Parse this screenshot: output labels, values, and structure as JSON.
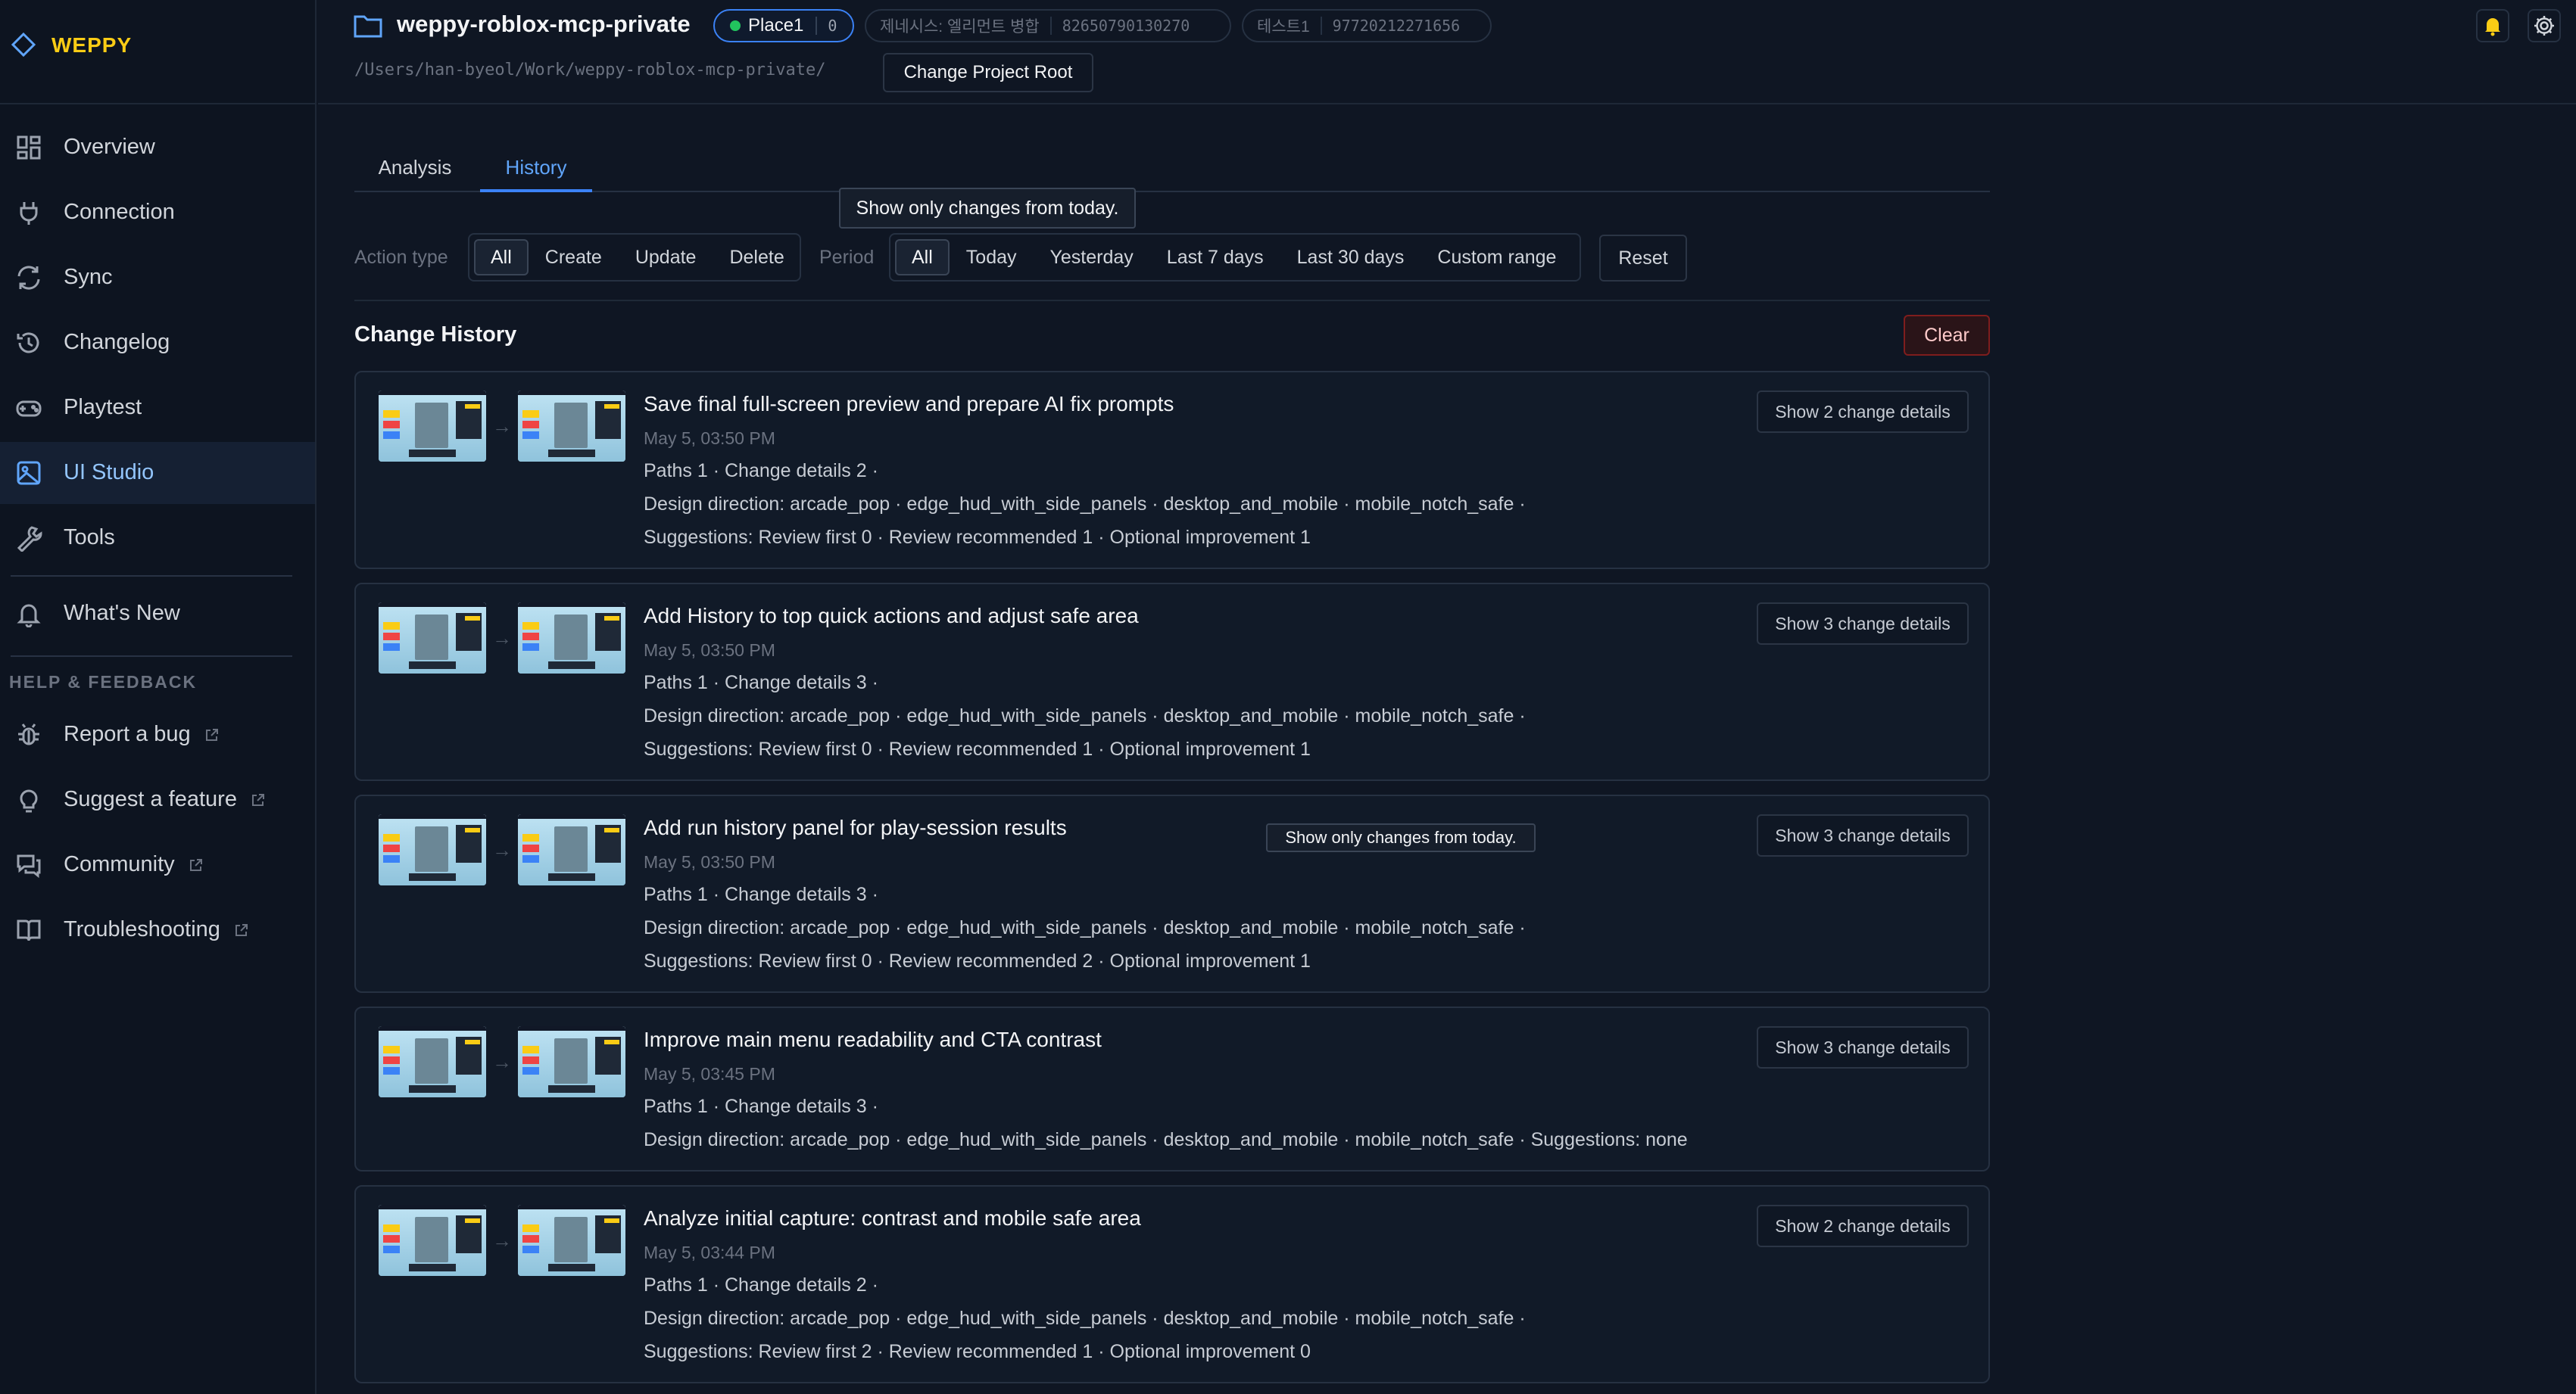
{
  "brand": {
    "name": "WEPPY"
  },
  "sidebar": {
    "items": [
      {
        "label": "Overview"
      },
      {
        "label": "Connection"
      },
      {
        "label": "Sync"
      },
      {
        "label": "Changelog"
      },
      {
        "label": "Playtest"
      },
      {
        "label": "UI Studio"
      },
      {
        "label": "Tools"
      },
      {
        "label": "What's New"
      }
    ],
    "help_title": "HELP & FEEDBACK",
    "help_items": [
      {
        "label": "Report a bug"
      },
      {
        "label": "Suggest a feature"
      },
      {
        "label": "Community"
      },
      {
        "label": "Troubleshooting"
      }
    ]
  },
  "header": {
    "project_name": "weppy-roblox-mcp-private",
    "place_name": "Place1",
    "place_count": "0",
    "meta1_label": "제네시스: 엘리먼트 병합",
    "meta1_id": "82650790130270",
    "meta2_label": "테스트1",
    "meta2_id": "97720212271656",
    "path": "/Users/han-byeol/Work/weppy-roblox-mcp-private/",
    "change_root_label": "Change Project Root"
  },
  "tabs": [
    {
      "label": "Analysis"
    },
    {
      "label": "History"
    }
  ],
  "tooltip_text": "Show only changes from today.",
  "filters": {
    "action_label": "Action type",
    "action_options": [
      "All",
      "Create",
      "Update",
      "Delete"
    ],
    "period_label": "Period",
    "period_options": [
      "All",
      "Today",
      "Yesterday",
      "Last 7 days",
      "Last 30 days",
      "Custom range"
    ],
    "reset_label": "Reset"
  },
  "history": {
    "title": "Change History",
    "clear_label": "Clear",
    "entries": [
      {
        "title": "Save final full-screen preview and prepare AI fix prompts",
        "time": "May 5, 03:50 PM",
        "paths": "Paths 1 · Change details 2 ·",
        "design": "Design direction: arcade_pop · edge_hud_with_side_panels · desktop_and_mobile · mobile_notch_safe ·",
        "suggestions": "Suggestions: Review first 0 · Review recommended 1 · Optional improvement 1",
        "button": "Show 2 change details"
      },
      {
        "title": "Add History to top quick actions and adjust safe area",
        "time": "May 5, 03:50 PM",
        "paths": "Paths 1 · Change details 3 ·",
        "design": "Design direction: arcade_pop · edge_hud_with_side_panels · desktop_and_mobile · mobile_notch_safe ·",
        "suggestions": "Suggestions: Review first 0 · Review recommended 1 · Optional improvement 1",
        "button": "Show 3 change details"
      },
      {
        "title": "Add run history panel for play-session results",
        "time": "May 5, 03:50 PM",
        "paths": "Paths 1 · Change details 3 ·",
        "design": "Design direction: arcade_pop · edge_hud_with_side_panels · desktop_and_mobile · mobile_notch_safe ·",
        "suggestions": "Suggestions: Review first 0 · Review recommended 2 · Optional improvement 1",
        "button": "Show 3 change details"
      },
      {
        "title": "Improve main menu readability and CTA contrast",
        "time": "May 5, 03:45 PM",
        "paths": "Paths 1 · Change details 3 ·",
        "design": "Design direction: arcade_pop · edge_hud_with_side_panels · desktop_and_mobile · mobile_notch_safe · Suggestions: none",
        "suggestions": "",
        "button": "Show 3 change details"
      },
      {
        "title": "Analyze initial capture: contrast and mobile safe area",
        "time": "May 5, 03:44 PM",
        "paths": "Paths 1 · Change details 2 ·",
        "design": "Design direction: arcade_pop · edge_hud_with_side_panels · desktop_and_mobile · mobile_notch_safe ·",
        "suggestions": "Suggestions: Review first 2 · Review recommended 1 · Optional improvement 0",
        "button": "Show 2 change details"
      }
    ]
  }
}
